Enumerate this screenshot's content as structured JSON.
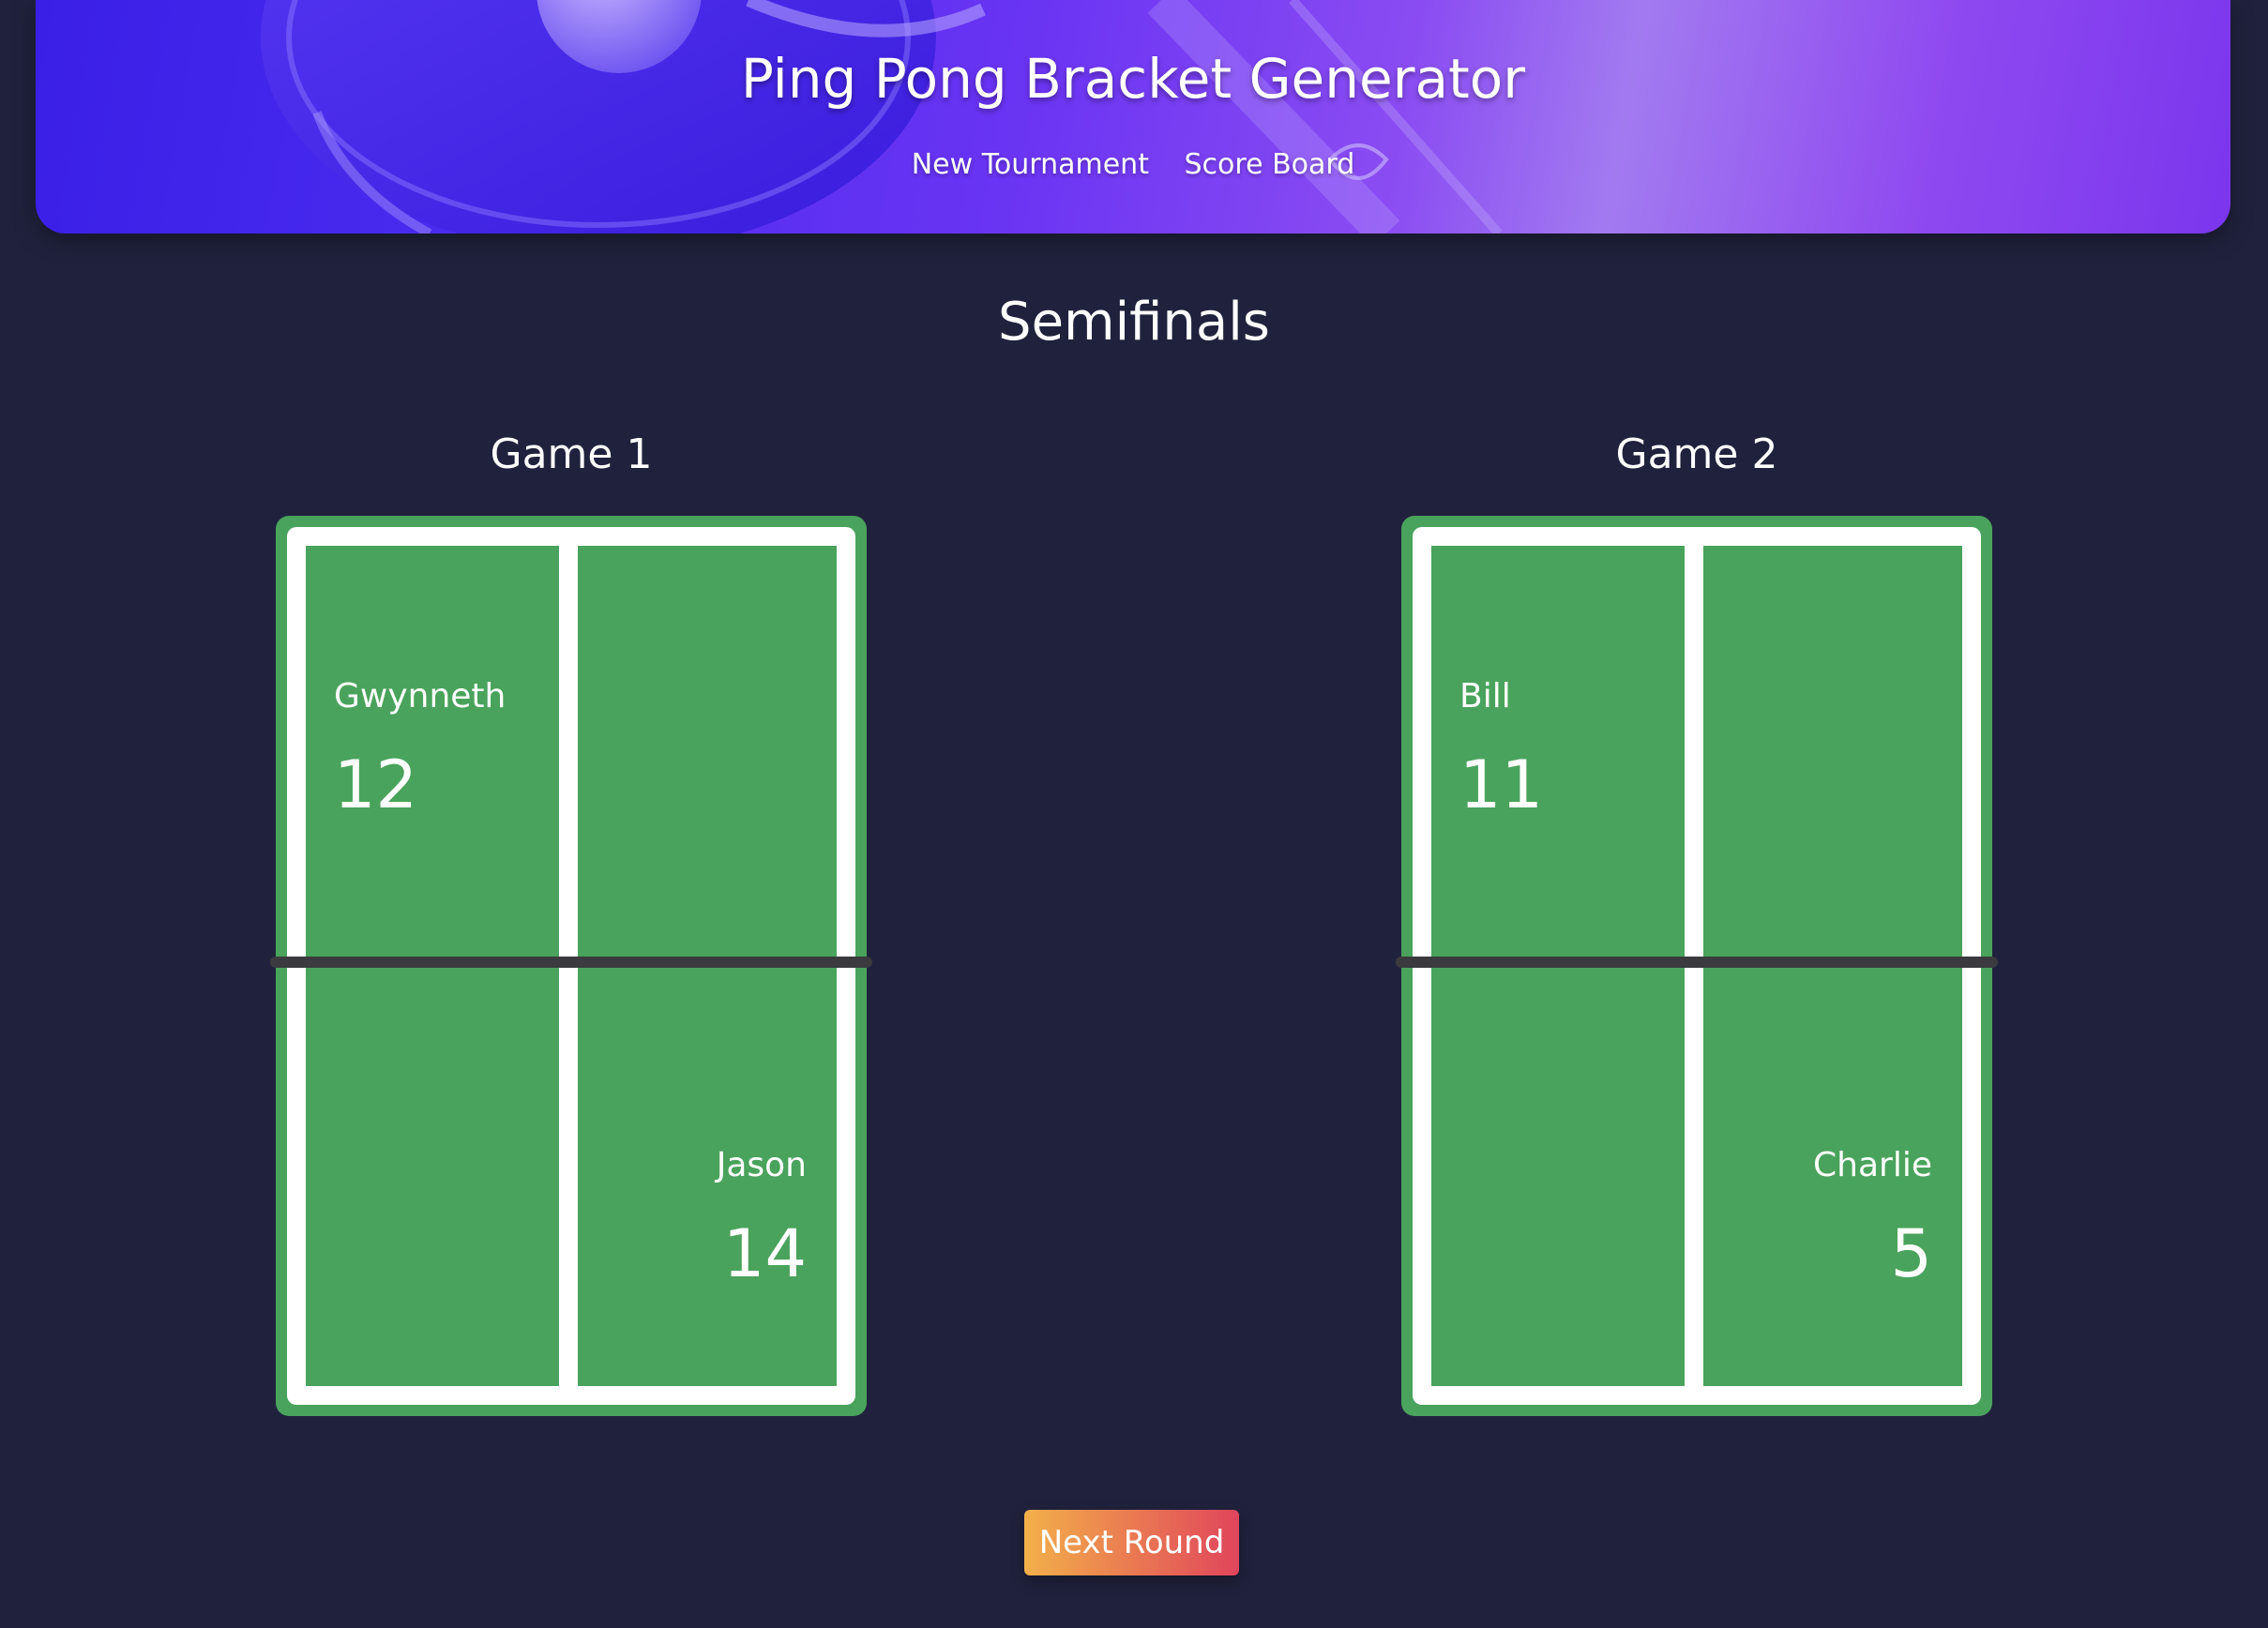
{
  "header": {
    "title": "Ping Pong Bracket Generator",
    "nav": [
      {
        "label": "New Tournament"
      },
      {
        "label": "Score Board"
      }
    ]
  },
  "round": {
    "title": "Semifinals"
  },
  "games": [
    {
      "title": "Game 1",
      "top_player": {
        "name": "Gwynneth",
        "score": "12"
      },
      "bottom_player": {
        "name": "Jason",
        "score": "14"
      }
    },
    {
      "title": "Game 2",
      "top_player": {
        "name": "Bill",
        "score": "11"
      },
      "bottom_player": {
        "name": "Charlie",
        "score": "5"
      }
    }
  ],
  "actions": {
    "next_round_label": "Next Round"
  },
  "colors": {
    "background": "#20223d",
    "table_green": "#4aa35c",
    "net": "#3b3b3f",
    "button_gradient_start": "#f2b04a",
    "button_gradient_end": "#e0455c"
  }
}
